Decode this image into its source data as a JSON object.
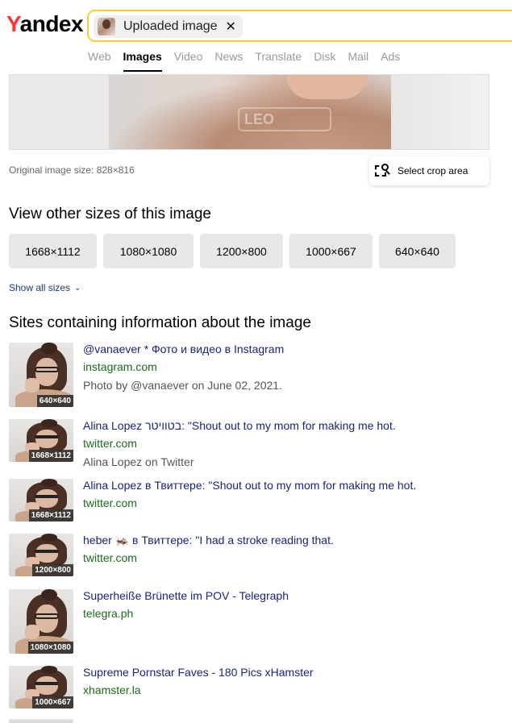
{
  "header": {
    "logo_initial": "Y",
    "logo_rest": "andex",
    "search_chip_label": "Uploaded image",
    "search_chip_close": "✕",
    "nav": [
      {
        "label": "Web",
        "active": false
      },
      {
        "label": "Images",
        "active": true
      },
      {
        "label": "Video",
        "active": false
      },
      {
        "label": "News",
        "active": false
      },
      {
        "label": "Translate",
        "active": false
      },
      {
        "label": "Disk",
        "active": false
      },
      {
        "label": "Mail",
        "active": false
      },
      {
        "label": "Ads",
        "active": false
      }
    ]
  },
  "preview": {
    "watermark": "LEO"
  },
  "original_size_text": "Original image size: 828×816",
  "crop_button_label": "Select crop area",
  "sizes_heading": "View other sizes of this image",
  "sizes": [
    "1668×1112",
    "1080×1080",
    "1200×800",
    "1000×667",
    "640×640"
  ],
  "show_all_label": "Show all sizes",
  "sites_heading": "Sites containing information about the image",
  "results": [
    {
      "title": "@vanaever * Фото и видео в Instagram",
      "domain": "instagram.com",
      "desc": "Photo by @vanaever on June 02, 2021.",
      "badge": "640×640"
    },
    {
      "title": "Alina Lopez בטוויטר: \"Shout out to my mom for making me hot.",
      "domain": "twitter.com",
      "desc": "Alina Lopez on Twitter",
      "badge": "1668×1112"
    },
    {
      "title": "Alina Lopez в Твиттере: \"Shout out to my mom for making me hot.",
      "domain": "twitter.com",
      "desc": "",
      "badge": "1668×1112"
    },
    {
      "title": "heber 🦗 в Твиттере: \"I had a stroke reading that.",
      "domain": "twitter.com",
      "desc": "",
      "badge": "1200×800"
    },
    {
      "title": "Superheiße Brünette im POV - Telegraph",
      "domain": "telegra.ph",
      "desc": "",
      "badge": "1080×1080"
    },
    {
      "title": "Supreme Pornstar Faves - 180 Pics xHamster",
      "domain": "xhamster.la",
      "desc": "",
      "badge": "1000×667"
    }
  ],
  "colors": {
    "logo_red": "#ff3333",
    "search_border": "#ffcc33",
    "link_blue": "#1a237e",
    "domain_green": "#1b6b1b"
  }
}
